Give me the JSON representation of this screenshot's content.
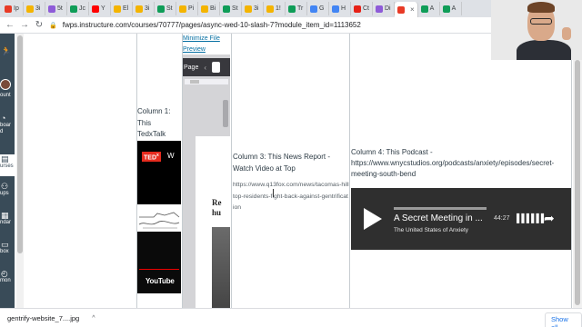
{
  "browser": {
    "tabs": [
      {
        "label": "Ip",
        "color": "#e83a26"
      },
      {
        "label": "3i",
        "color": "#f4b400"
      },
      {
        "label": "5t",
        "color": "#8e5bd8"
      },
      {
        "label": "Jc",
        "color": "#0f9d58"
      },
      {
        "label": "Y",
        "color": "#ff0000"
      },
      {
        "label": "El",
        "color": "#f4b400"
      },
      {
        "label": "3i",
        "color": "#f4b400"
      },
      {
        "label": "St",
        "color": "#0f9d58"
      },
      {
        "label": "Pi",
        "color": "#f4b400"
      },
      {
        "label": "Bi",
        "color": "#f4b400"
      },
      {
        "label": "St",
        "color": "#0f9d58"
      },
      {
        "label": "3i",
        "color": "#f4b400"
      },
      {
        "label": "1!",
        "color": "#f4b400"
      },
      {
        "label": "Tr",
        "color": "#0f9d58"
      },
      {
        "label": "G",
        "color": "#4285f4"
      },
      {
        "label": "H",
        "color": "#4285f4"
      },
      {
        "label": "Ct",
        "color": "#e62117"
      },
      {
        "label": "Di",
        "color": "#8e5bd8"
      },
      {
        "label": "",
        "color": "#e83a26",
        "active": true
      },
      {
        "label": "A",
        "color": "#0f9d58"
      },
      {
        "label": "A",
        "color": "#0f9d58"
      }
    ],
    "url": "fwps.instructure.com/courses/70777/pages/async-wed-10-slash-7?module_item_id=1113652"
  },
  "global_nav": {
    "items": [
      {
        "icon": "🏃",
        "label": ""
      },
      {
        "icon": "",
        "label": "ount"
      },
      {
        "icon": "◔",
        "label": "boar"
      },
      {
        "icon": "",
        "label": "d"
      },
      {
        "icon": "▤",
        "label": "urses"
      },
      {
        "icon": "⚇",
        "label": "ups"
      },
      {
        "icon": "▦",
        "label": "ndar"
      },
      {
        "icon": "▭",
        "label": "box"
      },
      {
        "icon": "◴",
        "label": "mon"
      }
    ]
  },
  "pdf": {
    "minimize_link": "Minimize File",
    "preview_link": "Preview",
    "toolbar_label": "Page",
    "page_text": "Re\nhu"
  },
  "col1": {
    "text": "Column 1: This TedxTalk",
    "ted_logo": "TED",
    "ted_x": "x",
    "ted_title": "W",
    "youtube_logo": "YouTube"
  },
  "col3": {
    "title": "Column 3: This News Report - Watch Video at Top",
    "url": "https://www.q13fox.com/news/tacomas-hilltop-residents-fight-back-against-gentrification"
  },
  "col4": {
    "title": "Column 4: This Podcast - https://www.wnycstudios.org/podcasts/anxiety/episodes/secret-meeting-south-bend",
    "podcast": {
      "title": "A Secret Meeting in ...",
      "subtitle": "The United States of Anxiety",
      "time": "44:27"
    }
  },
  "downloads": {
    "file": "gentrify-website_7....jpg",
    "show_all": "Show all"
  }
}
